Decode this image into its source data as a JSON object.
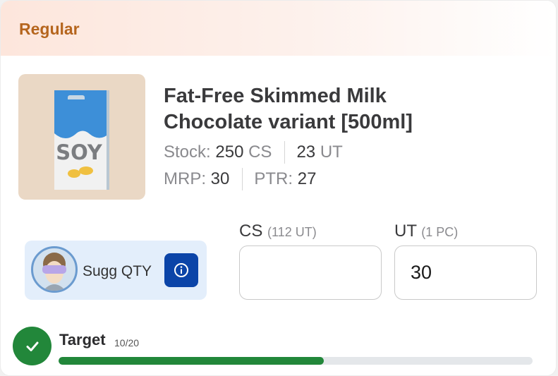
{
  "banner": {
    "label": "Regular"
  },
  "product": {
    "image_icon": "soy-milk-carton-icon",
    "image_text": "SOY",
    "title_line1": "Fat-Free Skimmed Milk",
    "title_line2": "Chocolate variant [500ml]",
    "stock_label": "Stock:",
    "stock_cs_value": "250",
    "stock_cs_unit": "CS",
    "stock_ut_value": "23",
    "stock_ut_unit": "UT",
    "mrp_label": "MRP:",
    "mrp_value": "30",
    "ptr_label": "PTR:",
    "ptr_value": "27"
  },
  "suggestion": {
    "avatar_icon": "vr-headset-avatar-icon",
    "label": "Sugg QTY",
    "info_icon": "info-icon"
  },
  "quantity": {
    "cs_label": "CS",
    "cs_sub": "(112 UT)",
    "cs_value": "",
    "ut_label": "UT",
    "ut_sub": "(1 PC)",
    "ut_value": "30"
  },
  "target": {
    "icon": "check-circle-icon",
    "label": "Target",
    "count": "10/20",
    "progress_fraction": 0.56
  },
  "colors": {
    "banner_text": "#b5651d",
    "info_button": "#0b44a8",
    "success": "#22873a",
    "thumb_bg": "#ead8c5"
  }
}
